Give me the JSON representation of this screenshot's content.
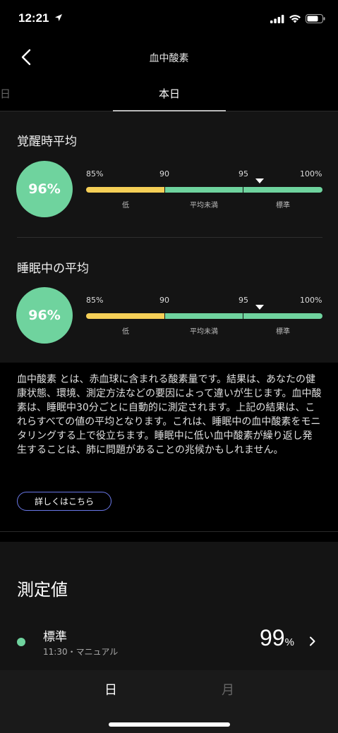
{
  "status_bar": {
    "time": "12:21"
  },
  "header": {
    "title": "血中酸素"
  },
  "tabs": {
    "previous": "日",
    "current": "本日"
  },
  "awake": {
    "title": "覚醒時平均",
    "value": "96%",
    "ticks": [
      "85%",
      "90",
      "95",
      "100%"
    ],
    "categories": [
      "低",
      "平均未満",
      "標準"
    ],
    "marker_value": 96
  },
  "sleep": {
    "title": "睡眠中の平均",
    "value": "96%",
    "ticks": [
      "85%",
      "90",
      "95",
      "100%"
    ],
    "categories": [
      "低",
      "平均未満",
      "標準"
    ],
    "marker_value": 96
  },
  "description": {
    "text": "血中酸素 とは、赤血球に含まれる酸素量です。結果は、あなたの健康状態、環境、測定方法などの要因によって違いが生じます。血中酸素は、睡眠中30分ごとに自動的に測定されます。上記の結果は、これらすべての値の平均となります。これは、睡眠中の血中酸素をモニタリングする上で役立ちます。睡眠中に低い血中酸素が繰り返し発生することは、肺に問題があることの兆候かもしれません。",
    "more_button": "詳しくはこちら"
  },
  "measurements": {
    "title": "測定値",
    "items": [
      {
        "label": "標準",
        "sub": "11:30・マニュアル",
        "value": "99",
        "unit": "%"
      }
    ]
  },
  "bottom_tabs": {
    "day": "日",
    "month": "月"
  },
  "colors": {
    "green": "#6fd39e",
    "yellow": "#f5cf57",
    "link_border": "#6a78e8"
  }
}
